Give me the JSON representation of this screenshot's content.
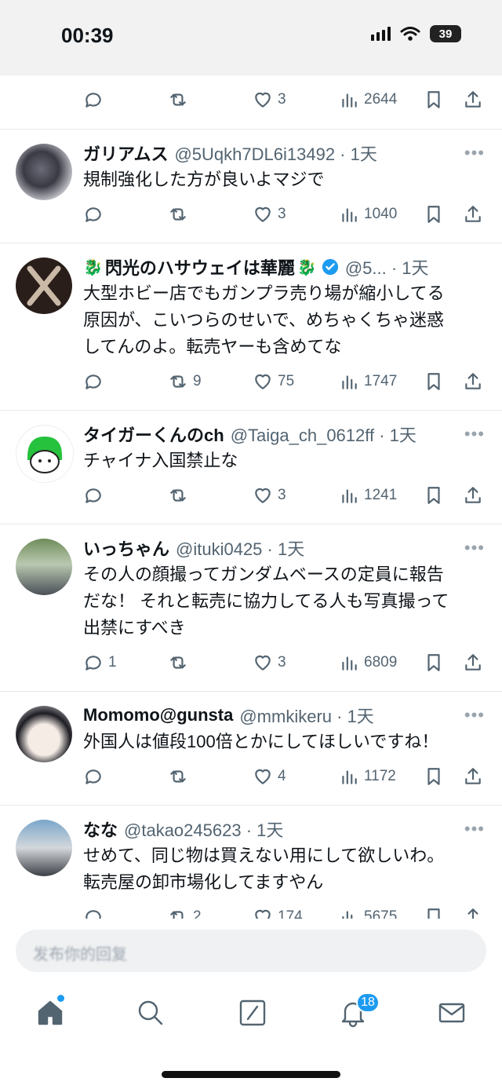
{
  "status": {
    "time": "00:39",
    "battery": "39"
  },
  "partial_top": {
    "actions": {
      "reply": "",
      "retweet": "",
      "like": "3",
      "views": "2644"
    }
  },
  "tweets": [
    {
      "name": "ガリアムス",
      "handle": "@5Uqkh7DL6i13492 · 1天",
      "text": [
        "規制強化した方が良いよマジで"
      ],
      "actions": {
        "reply": "",
        "retweet": "",
        "like": "3",
        "views": "1040"
      }
    },
    {
      "name": "閃光のハサウェイは華麗",
      "handle": "@5... · 1天",
      "text": [
        "大型ホビー店でもガンプラ売り場が縮小してる",
        "原因が、こいつらのせいで、めちゃくちゃ迷惑",
        "してんのよ。転売ヤーも含めてな"
      ],
      "actions": {
        "reply": "",
        "retweet": "9",
        "like": "75",
        "views": "1747"
      }
    },
    {
      "name": "タイガーくんのch",
      "handle": "@Taiga_ch_0612ff · 1天",
      "text": [
        "チャイナ入国禁止な"
      ],
      "actions": {
        "reply": "",
        "retweet": "",
        "like": "3",
        "views": "1241"
      }
    },
    {
      "name": "いっちゃん",
      "handle": "@ituki0425 · 1天",
      "text": [
        "その人の顔撮ってガンダムベースの定員に報告",
        "だな！ それと転売に協力してる人も写真撮って",
        "出禁にすべき"
      ],
      "actions": {
        "reply": "1",
        "retweet": "",
        "like": "3",
        "views": "6809"
      }
    },
    {
      "name": "Momomo@gunsta",
      "handle": "@mmkikeru · 1天",
      "text": [
        "外国人は値段100倍とかにしてほしいですね！"
      ],
      "actions": {
        "reply": "",
        "retweet": "",
        "like": "4",
        "views": "1172"
      }
    },
    {
      "name": "なな",
      "handle": "@takao245623 · 1天",
      "text": [
        "せめて、同じ物は買えない用にして欲しいわ。",
        "転売屋の卸市場化してますやん"
      ],
      "actions": {
        "reply": "",
        "retweet": "2",
        "like": "174",
        "views": "5675"
      }
    }
  ],
  "more_label": "•••",
  "reply_placeholder": "发布你的回复",
  "tabs": {
    "notifications_badge": "18"
  }
}
